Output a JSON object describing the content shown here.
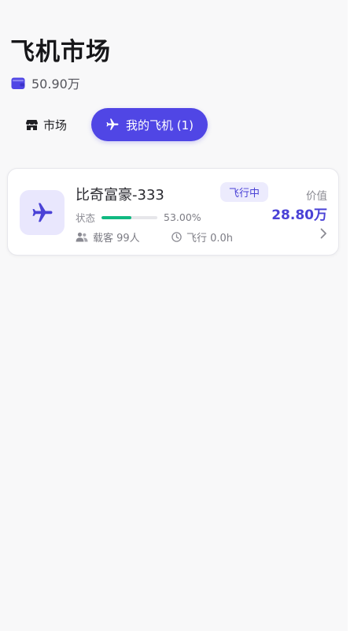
{
  "header": {
    "title": "飞机市场",
    "balance": "50.90万",
    "wallet_icon": "wallet-icon"
  },
  "tabs": [
    {
      "label": "市场",
      "icon": "store-icon",
      "active": false
    },
    {
      "label": "我的飞机 (1)",
      "icon": "airplane-icon",
      "active": true
    }
  ],
  "colors": {
    "accent": "#5046e5",
    "progress": "#10b981",
    "pill_bg": "#ecebfd",
    "icon_bg": "#e9e7fd"
  },
  "planes": [
    {
      "name": "比奇富豪-333",
      "status_badge": "飞行中",
      "status_label": "状态",
      "condition_percent": 53,
      "condition_text": "53.00%",
      "passengers": "载客 99人",
      "flight_time": "飞行 0.0h",
      "price_label": "价值",
      "price": "28.80万"
    }
  ]
}
